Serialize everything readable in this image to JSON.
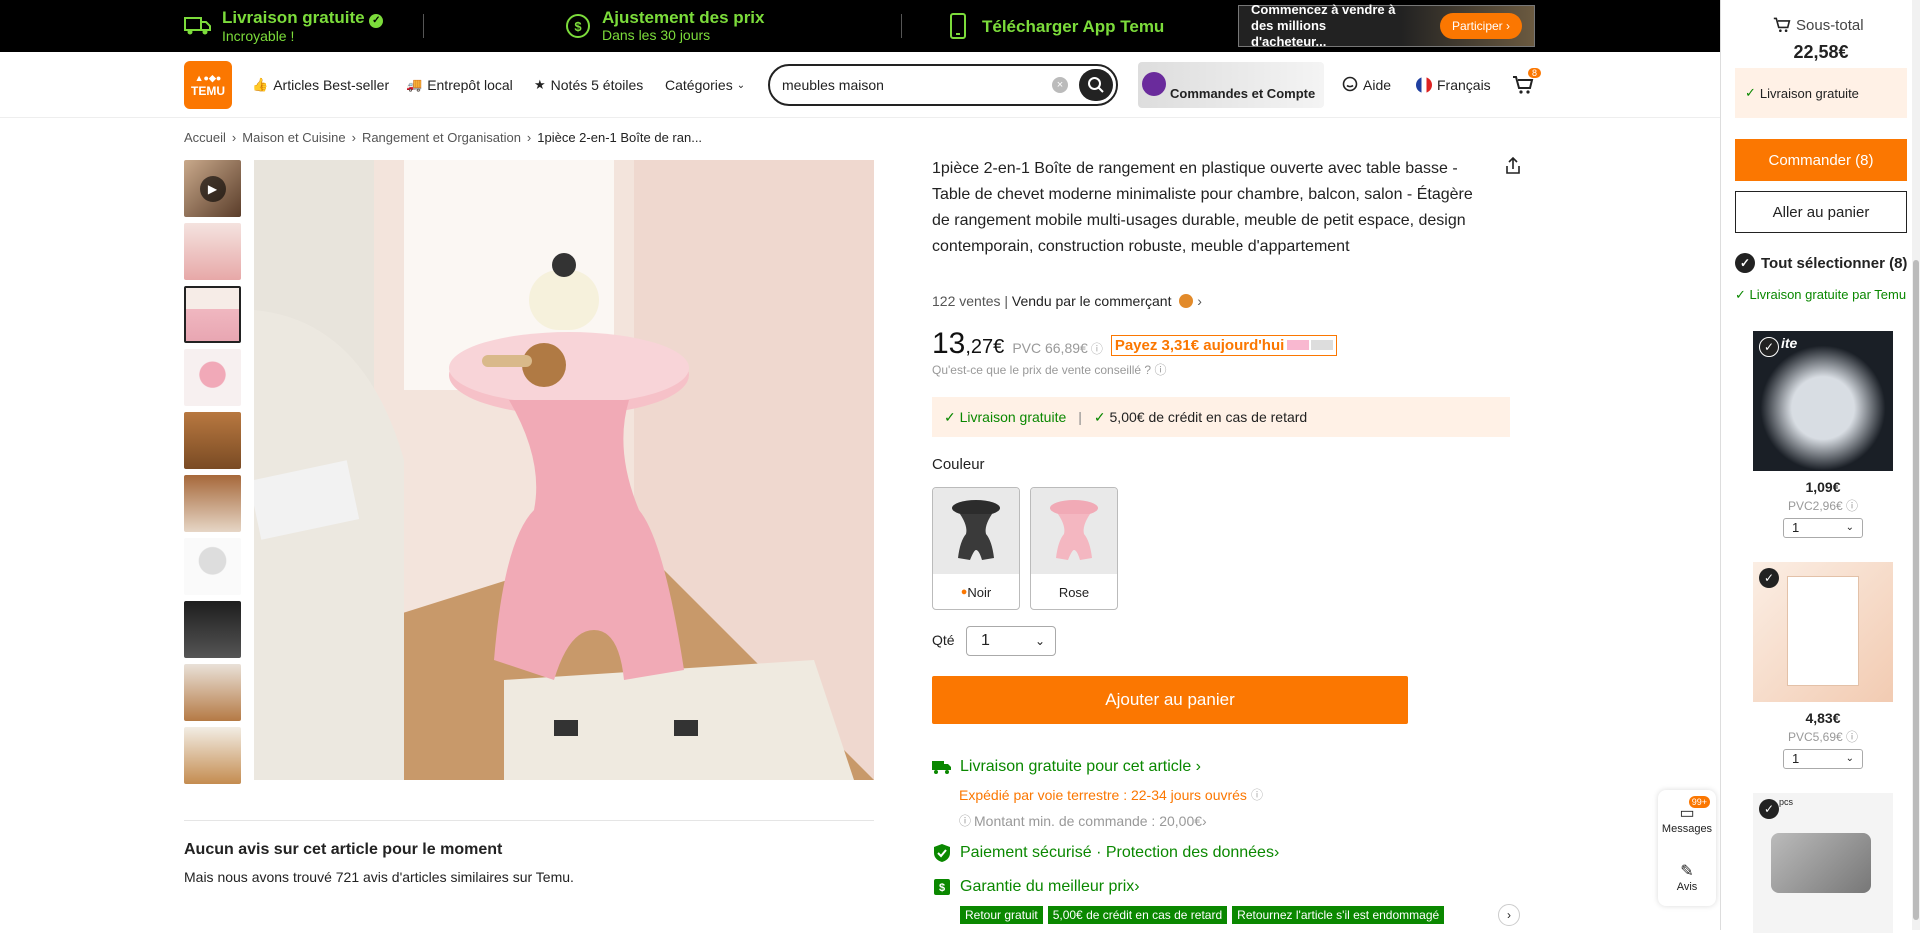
{
  "topbar": {
    "free_shipping_title": "Livraison gratuite",
    "free_shipping_sub": "Incroyable !",
    "price_adjust_title": "Ajustement des prix",
    "price_adjust_sub": "Dans les 30 jours",
    "app_title": "Télécharger App Temu",
    "seller_text": "Commencez à vendre à des millions d'acheteur...",
    "seller_button": "Participer ›"
  },
  "header": {
    "logo_text": "TEMU",
    "nav": [
      "Articles Best-seller",
      "Entrepôt local",
      "Notés 5 étoiles",
      "Catégories"
    ],
    "search_value": "meubles maison",
    "account_label": "Commandes et Compte",
    "help": "Aide",
    "language": "Français",
    "cart_count": "8"
  },
  "breadcrumb": [
    "Accueil",
    "Maison et Cuisine",
    "Rangement et Organisation",
    "1pièce 2-en-1 Boîte de ran..."
  ],
  "product": {
    "title": "1pièce 2-en-1 Boîte de rangement en plastique ouverte avec table basse - Table de chevet moderne minimaliste pour chambre, balcon, salon - Étagère de rangement mobile multi-usages durable, meuble de petit espace, design contemporain, construction robuste, meuble d'appartement",
    "sales": "122 ventes",
    "sold_by": "Vendu par le commerçant",
    "price_main": "13",
    "price_cents": ",27€",
    "pvc": "PVC 66,89€",
    "pay_today": "Payez 3,31€ aujourd'hui",
    "pvc_question": "Qu'est-ce que le prix de vente conseillé ?",
    "free_shipping": "Livraison gratuite",
    "credit": "5,00€ de crédit en cas de retard",
    "color_label": "Couleur",
    "colors": [
      "Noir",
      "Rose"
    ],
    "qty_label": "Qté",
    "qty_value": "1",
    "add_to_cart": "Ajouter au panier",
    "ship_title": "Livraison gratuite pour cet article",
    "ship_method": "Expédié par voie terrestre : 22-34 jours ouvrés",
    "min_order": "Montant min. de commande : 20,00€",
    "secure": "Paiement sécurisé · Protection des données",
    "best_price": "Garantie du meilleur prix",
    "tags": [
      "Retour gratuit",
      "5,00€ de crédit en cas de retard",
      "Retournez l'article s'il est endommagé"
    ]
  },
  "reviews": {
    "title": "Aucun avis sur cet article pour le moment",
    "subtitle": "Mais nous avons trouvé 721 avis d'articles similaires sur Temu."
  },
  "floating": {
    "messages": "Messages",
    "messages_badge": "99+",
    "reviews": "Avis"
  },
  "sidecart": {
    "subtotal_label": "Sous-total",
    "subtotal": "22,58€",
    "free_shipping": "Livraison gratuite",
    "order_button": "Commander (8)",
    "cart_button": "Aller au panier",
    "select_all": "Tout sélectionner (8)",
    "free_by": "Livraison gratuite par Temu",
    "items": [
      {
        "price": "1,09€",
        "pvc": "PVC2,96€",
        "qty": "1",
        "overlay": "ite"
      },
      {
        "price": "4,83€",
        "pvc": "PVC5,69€",
        "qty": "1",
        "overlay": ""
      },
      {
        "price": "",
        "pvc": "",
        "qty": "",
        "overlay": "pcs"
      }
    ]
  },
  "colors": {
    "accent": "#FB7701",
    "green": "#0A8800",
    "topbar_green": "#7CDC3B"
  }
}
